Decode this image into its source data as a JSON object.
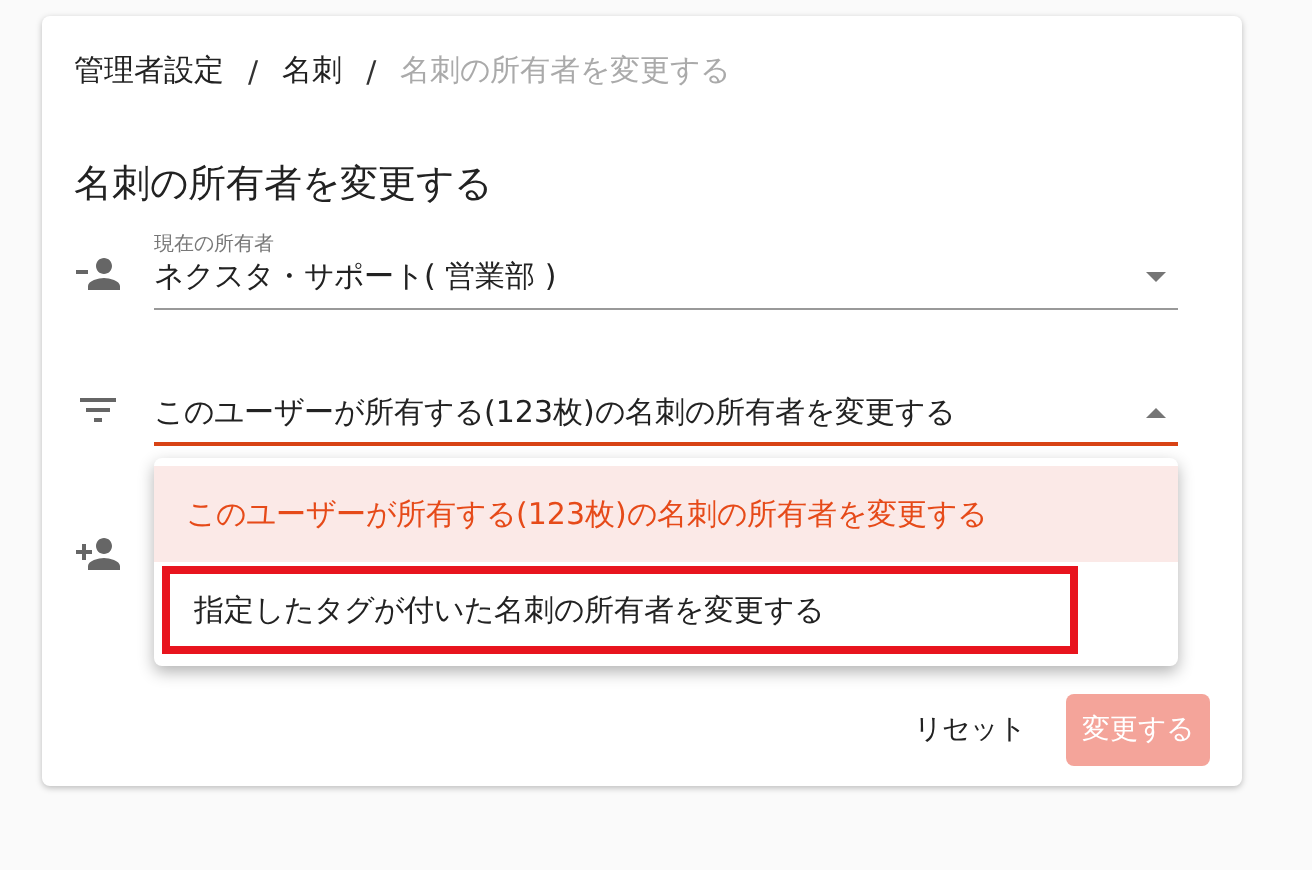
{
  "breadcrumb": [
    {
      "label": "管理者設定",
      "current": false
    },
    {
      "label": "名刺",
      "current": false
    },
    {
      "label": "名刺の所有者を変更する",
      "current": true
    }
  ],
  "breadcrumb_separator": "/",
  "title": "名刺の所有者を変更する",
  "owner_field": {
    "label": "現在の所有者",
    "value": "ネクスタ・サポート( 営業部 )"
  },
  "mode_select": {
    "value": "このユーザーが所有する(123枚)の名刺の所有者を変更する",
    "expanded": true
  },
  "menu_options": [
    {
      "label": "このユーザーが所有する(123枚)の名刺の所有者を変更する",
      "selected": true,
      "highlighted": false
    },
    {
      "label": "指定したタグが付いた名刺の所有者を変更する",
      "selected": false,
      "highlighted": true
    }
  ],
  "buttons": [
    {
      "label": "リセット",
      "kind": "text"
    },
    {
      "label": "変更する",
      "kind": "primary",
      "disabled": true
    }
  ]
}
